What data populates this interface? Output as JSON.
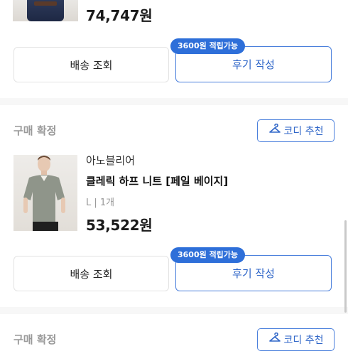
{
  "order1": {
    "price": "74,747원",
    "ship_label": "배송 조회",
    "review_label": "후기 작성",
    "points_badge": "3600원 적립가능"
  },
  "section2": {
    "title": "구매 확정",
    "codi_label": "코디 추천"
  },
  "order2": {
    "brand": "아노블리어",
    "product_name": "클레릭 하프 니트 [페일 베이지]",
    "option": "L | 1개",
    "price": "53,522원",
    "ship_label": "배송 조회",
    "review_label": "후기 작성",
    "points_badge": "3600원 적립가능"
  },
  "section3": {
    "title": "구매 확정",
    "codi_label": "코디 추천"
  },
  "colors": {
    "accent": "#2e6fd9",
    "accent_text": "#2f66c8",
    "muted": "#9a9a9a"
  }
}
